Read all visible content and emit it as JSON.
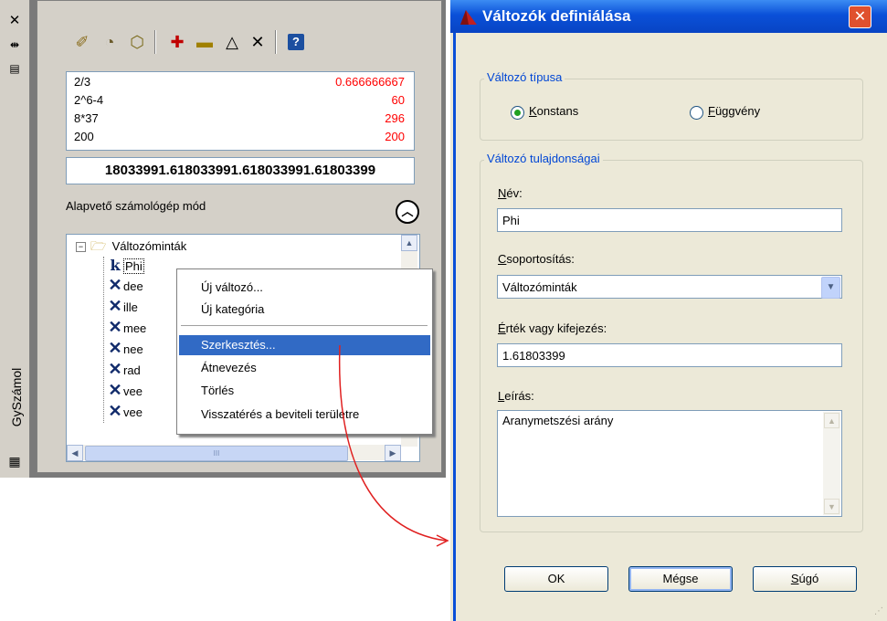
{
  "palette": {
    "title": "GySzámol",
    "history": [
      {
        "expr": "2/3",
        "result": "0.666666667"
      },
      {
        "expr": "2^6-4",
        "result": "60"
      },
      {
        "expr": "8*37",
        "result": "296"
      },
      {
        "expr": "200",
        "result": "200"
      }
    ],
    "display_value": "18033991.618033991.618033991.61803399",
    "mode_label": "Alapvető számológép mód",
    "tree": {
      "root": "Változóminták",
      "items": [
        "Phi",
        "dee",
        "ille",
        "mee",
        "nee",
        "rad",
        "vee",
        "vee"
      ]
    },
    "context_menu": {
      "items": [
        "Új változó...",
        "Új kategória",
        "Szerkesztés...",
        "Átnevezés",
        "Törlés",
        "Visszatérés a beviteli területre"
      ],
      "selected": "Szerkesztés..."
    },
    "scroll_thumb_glyph": "III"
  },
  "dialog": {
    "title": "Változók definiálása",
    "type_group": {
      "legend": "Változó típusa",
      "options": [
        {
          "prefix": "",
          "mnemonic": "K",
          "rest": "onstans",
          "selected": true
        },
        {
          "prefix": "",
          "mnemonic": "F",
          "rest": "üggvény",
          "selected": false
        }
      ]
    },
    "props_group": {
      "legend": "Változó tulajdonságai",
      "name_label": {
        "mnemonic": "N",
        "rest": "év:"
      },
      "name_value": "Phi",
      "group_label": {
        "mnemonic": "C",
        "rest": "soportosítás:"
      },
      "group_value": "Változóminták",
      "value_label": {
        "mnemonic": "É",
        "rest": "rték vagy kifejezés:"
      },
      "value_value": "1.61803399",
      "desc_label": {
        "mnemonic": "L",
        "rest": "eírás:"
      },
      "desc_value": "Aranymetszési arány"
    },
    "buttons": {
      "ok": "OK",
      "cancel": "Mégse",
      "help": {
        "mnemonic": "S",
        "rest": "úgó"
      }
    }
  },
  "colors": {
    "result_red": "#ff0000",
    "legend_blue": "#0046d5",
    "selection_blue": "#316ac5",
    "titlebar_blue": "#0a50d8",
    "close_red": "#e0502e"
  }
}
